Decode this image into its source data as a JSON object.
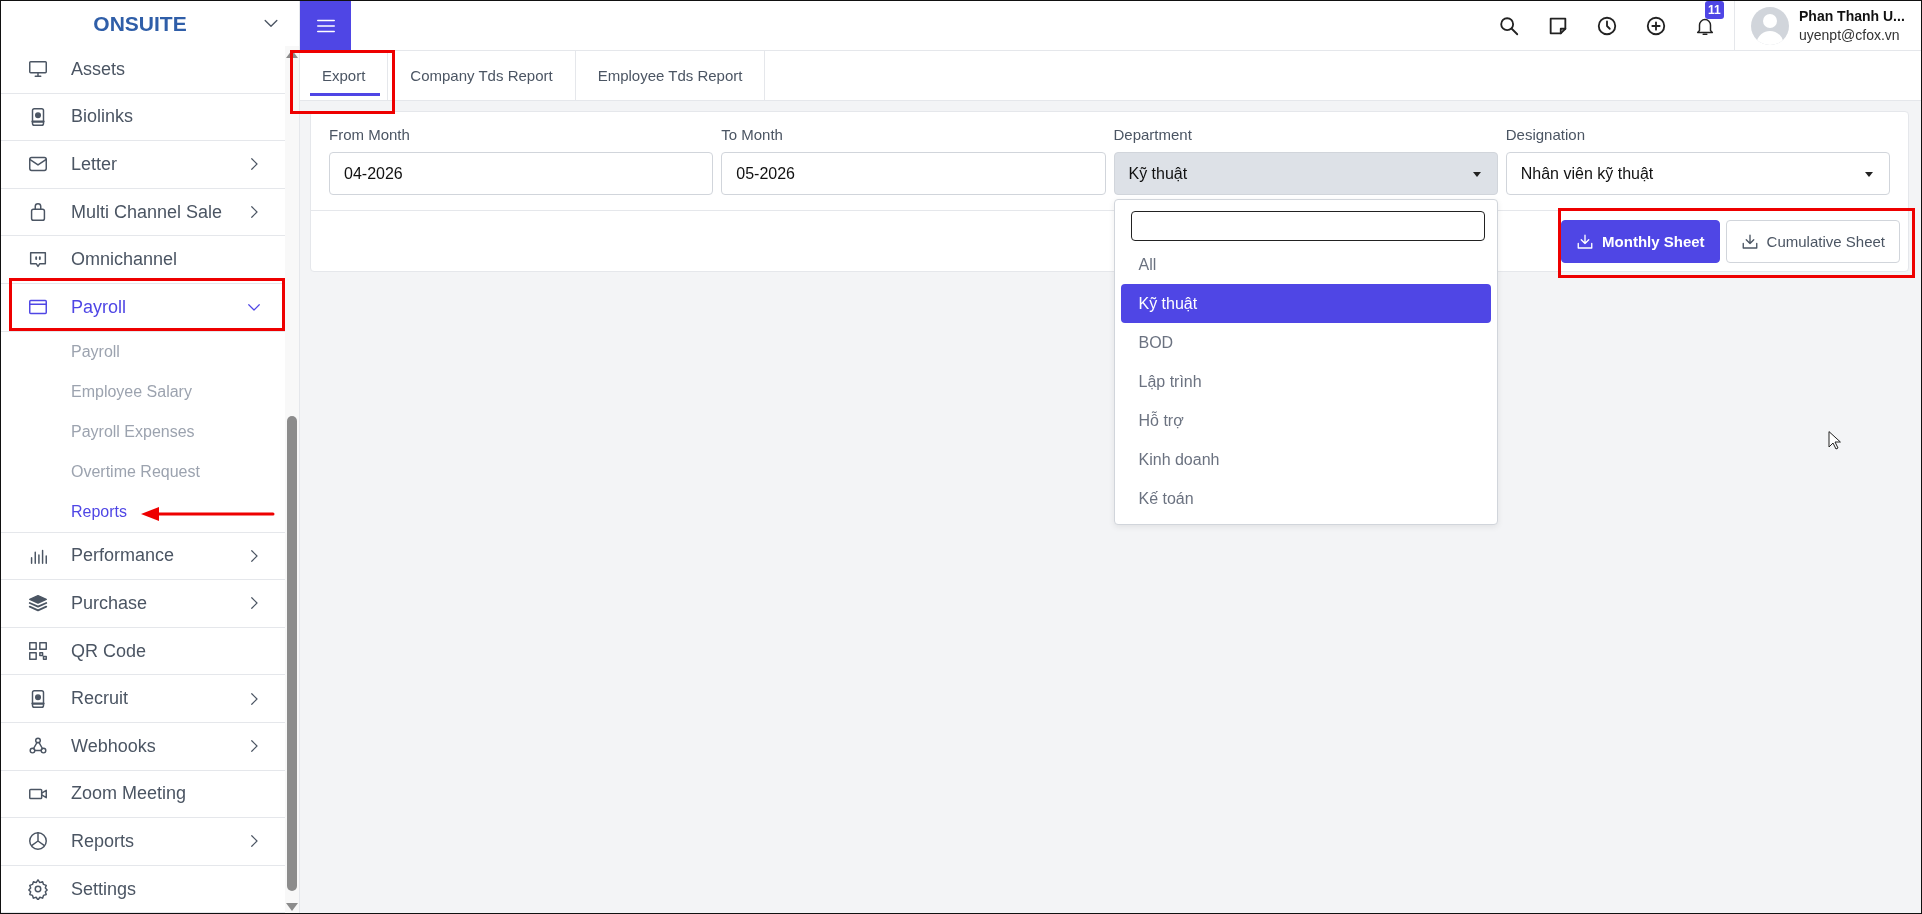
{
  "brand": {
    "name": "ONSUITE"
  },
  "sidebar": {
    "items": [
      {
        "label": "Assets",
        "kind": "link",
        "selected": false
      },
      {
        "label": "Biolinks",
        "kind": "link",
        "selected": false
      },
      {
        "label": "Letter",
        "kind": "group",
        "expanded": false,
        "selected": false
      },
      {
        "label": "Multi Channel Sale",
        "kind": "group",
        "expanded": false,
        "selected": false
      },
      {
        "label": "Omnichannel",
        "kind": "link",
        "selected": false
      },
      {
        "label": "Payroll",
        "kind": "group",
        "expanded": true,
        "selected": true,
        "children": [
          {
            "label": "Payroll",
            "selected": false
          },
          {
            "label": "Employee Salary",
            "selected": false
          },
          {
            "label": "Payroll Expenses",
            "selected": false
          },
          {
            "label": "Overtime Request",
            "selected": false
          },
          {
            "label": "Reports",
            "selected": true
          }
        ]
      },
      {
        "label": "Performance",
        "kind": "group",
        "expanded": false,
        "selected": false
      },
      {
        "label": "Purchase",
        "kind": "group",
        "expanded": false,
        "selected": false
      },
      {
        "label": "QR Code",
        "kind": "link",
        "selected": false
      },
      {
        "label": "Recruit",
        "kind": "group",
        "expanded": false,
        "selected": false
      },
      {
        "label": "Webhooks",
        "kind": "group",
        "expanded": false,
        "selected": false
      },
      {
        "label": "Zoom Meeting",
        "kind": "link",
        "selected": false
      },
      {
        "label": "Reports",
        "kind": "group",
        "expanded": false,
        "selected": false
      },
      {
        "label": "Settings",
        "kind": "link",
        "selected": false
      }
    ]
  },
  "top_bar": {
    "notification_count": "11",
    "user": {
      "name": "Phan Thanh U...",
      "email": "uyenpt@cfox.vn"
    }
  },
  "tabs": [
    {
      "label": "Export",
      "selected": true
    },
    {
      "label": "Company Tds Report",
      "selected": false
    },
    {
      "label": "Employee Tds Report",
      "selected": false
    }
  ],
  "filters": [
    {
      "label": "From Month",
      "kind": "text",
      "value": "04-2026"
    },
    {
      "label": "To Month",
      "kind": "text",
      "value": "05-2026"
    },
    {
      "label": "Department",
      "kind": "select",
      "value": "Kỹ thuật",
      "open": true,
      "options": [
        {
          "label": "All",
          "selected": false
        },
        {
          "label": "Kỹ thuật",
          "selected": true
        },
        {
          "label": "BOD",
          "selected": false
        },
        {
          "label": "Lập trình",
          "selected": false
        },
        {
          "label": "Hỗ trợ",
          "selected": false
        },
        {
          "label": "Kinh doanh",
          "selected": false
        },
        {
          "label": "Kế toán",
          "selected": false
        }
      ]
    },
    {
      "label": "Designation",
      "kind": "select",
      "value": "Nhân viên kỹ thuật",
      "open": false
    }
  ],
  "buttons": [
    {
      "label": "Monthly Sheet",
      "kind": "primary"
    },
    {
      "label": "Cumulative Sheet",
      "kind": "secondary"
    }
  ]
}
